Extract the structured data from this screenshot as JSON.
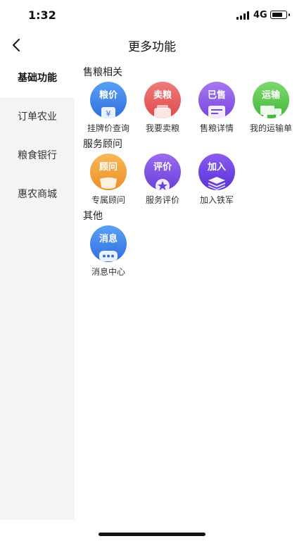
{
  "status_bar": {
    "time": "1:32",
    "network": "4G",
    "battery_level": 0.8
  },
  "nav": {
    "title": "更多功能"
  },
  "sidebar": {
    "items": [
      {
        "label": "基础功能",
        "active": true
      },
      {
        "label": "订单农业",
        "active": false
      },
      {
        "label": "粮食银行",
        "active": false
      },
      {
        "label": "惠农商城",
        "active": false
      }
    ]
  },
  "sections": [
    {
      "title": "售粮相关",
      "items": [
        {
          "tag": "粮价",
          "label": "挂牌价查询",
          "icon": "price-icon",
          "color_top": "#5aa0f5",
          "color_bottom": "#2f6fe0"
        },
        {
          "tag": "卖粮",
          "label": "我要卖粮",
          "icon": "sell-grain-icon",
          "color_top": "#f07a7a",
          "color_bottom": "#de4a4a"
        },
        {
          "tag": "已售",
          "label": "售粮详情",
          "icon": "sold-detail-icon",
          "color_top": "#a479f0",
          "color_bottom": "#7a46de"
        },
        {
          "tag": "运输",
          "label": "我的运输单",
          "icon": "truck-icon",
          "color_top": "#7fd870",
          "color_bottom": "#42b83a"
        }
      ]
    },
    {
      "title": "服务顾问",
      "items": [
        {
          "tag": "顾问",
          "label": "专属顾问",
          "icon": "advisor-icon",
          "color_top": "#f7b85a",
          "color_bottom": "#ec8f28"
        },
        {
          "tag": "评价",
          "label": "服务评价",
          "icon": "star-icon",
          "color_top": "#9a6cf0",
          "color_bottom": "#6a3fdc"
        },
        {
          "tag": "加入",
          "label": "加入铁军",
          "icon": "layers-icon",
          "color_top": "#8a5cf0",
          "color_bottom": "#5a30d8"
        }
      ]
    },
    {
      "title": "其他",
      "items": [
        {
          "tag": "消息",
          "label": "消息中心",
          "icon": "message-icon",
          "color_top": "#5aa0f5",
          "color_bottom": "#2f6fe0"
        }
      ]
    }
  ]
}
